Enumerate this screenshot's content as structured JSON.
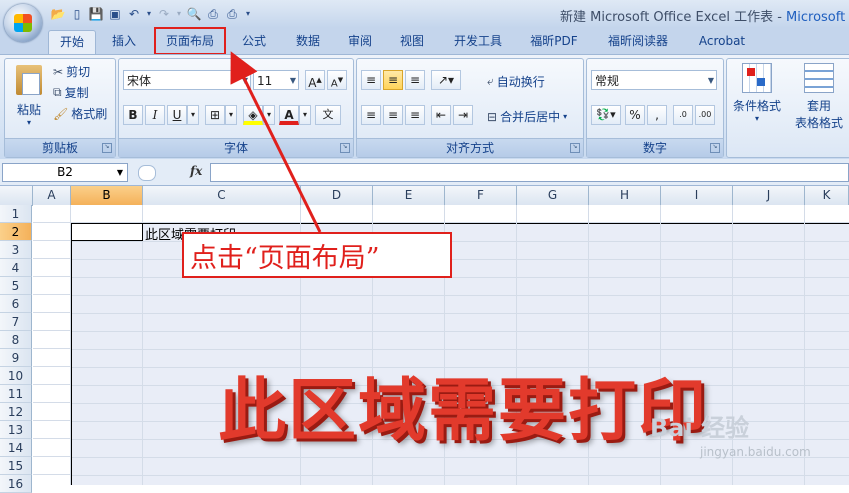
{
  "window": {
    "title": "新建 Microsoft Office Excel 工作表 - ",
    "app": "Microsoft"
  },
  "qat": {
    "icons": [
      "open-icon",
      "new-icon",
      "save-icon",
      "print-preview-icon",
      "undo-icon",
      "redo-icon",
      "print-icon",
      "print2-icon",
      "customize-icon"
    ]
  },
  "tabs": [
    "开始",
    "插入",
    "页面布局",
    "公式",
    "数据",
    "审阅",
    "视图",
    "开发工具",
    "福昕PDF",
    "福昕阅读器",
    "Acrobat"
  ],
  "active_tab": "开始",
  "highlighted_tab": "页面布局",
  "ribbon": {
    "clipboard": {
      "label": "剪贴板",
      "paste": "粘贴",
      "cut": "剪切",
      "copy": "复制",
      "format_painter": "格式刷"
    },
    "font": {
      "label": "字体",
      "font_name": "宋体",
      "font_size": "11"
    },
    "alignment": {
      "label": "对齐方式",
      "wrap_text": "自动换行",
      "merge_center": "合并后居中"
    },
    "number": {
      "label": "数字",
      "format": "常规",
      "percent": "%",
      "comma": ","
    },
    "styles": {
      "conditional": "条件格式",
      "table_format_1": "套用",
      "table_format_2": "表格格式"
    }
  },
  "formula_bar": {
    "name_box": "B2",
    "fx": "fx",
    "content": ""
  },
  "columns": [
    "A",
    "B",
    "C",
    "D",
    "E",
    "F",
    "G",
    "H",
    "I",
    "J",
    "K"
  ],
  "selected_column": "B",
  "rows": [
    "1",
    "2",
    "3",
    "4",
    "5",
    "6",
    "7",
    "8",
    "9",
    "10",
    "11",
    "12",
    "13",
    "14",
    "15",
    "16"
  ],
  "selected_row": "2",
  "cell_c2": "此区域需要打印",
  "annotation": "点击“页面布局”",
  "big_text": "此区域需要打印",
  "watermark": {
    "main": "Bai  经验",
    "url": "jingyan.baidu.com"
  },
  "colors": {
    "accent_red": "#e0201c",
    "big_text": "#e23a2c",
    "selected_header": "#f4b15a",
    "ribbon_blue": "#15428b"
  }
}
